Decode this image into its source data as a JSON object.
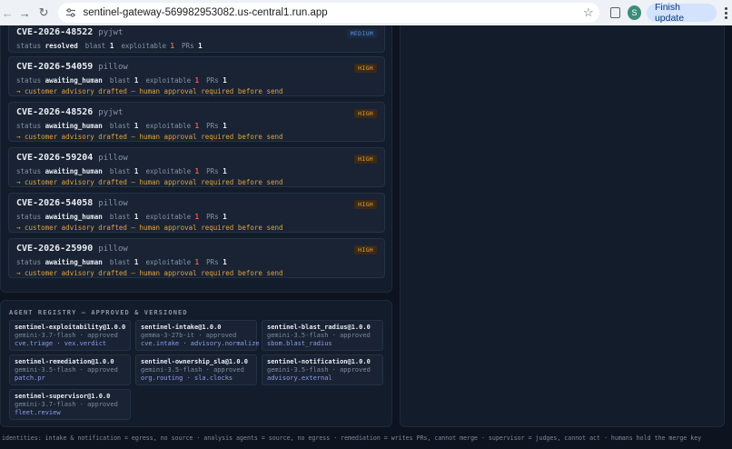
{
  "browser": {
    "url": "sentinel-gateway-569982953082.us-central1.run.app",
    "avatar_letter": "S",
    "finish_update_label": "Finish update"
  },
  "labels": {
    "status": "status",
    "blast": "blast",
    "exploitable": "exploitable",
    "prs": "PRs"
  },
  "incidents": [
    {
      "cve": "CVE-2026-48522",
      "package": "pyjwt",
      "severity": "MEDIUM",
      "status": "resolved",
      "blast": "1",
      "exploitable": "1",
      "prs": "1",
      "note": ""
    },
    {
      "cve": "CVE-2026-54059",
      "package": "pillow",
      "severity": "HIGH",
      "status": "awaiting_human",
      "blast": "1",
      "exploitable": "1",
      "prs": "1",
      "note": "→ customer advisory drafted — human approval required before send"
    },
    {
      "cve": "CVE-2026-48526",
      "package": "pyjwt",
      "severity": "HIGH",
      "status": "awaiting_human",
      "blast": "1",
      "exploitable": "1",
      "prs": "1",
      "note": "→ customer advisory drafted — human approval required before send"
    },
    {
      "cve": "CVE-2026-59204",
      "package": "pillow",
      "severity": "HIGH",
      "status": "awaiting_human",
      "blast": "1",
      "exploitable": "1",
      "prs": "1",
      "note": "→ customer advisory drafted — human approval required before send"
    },
    {
      "cve": "CVE-2026-54058",
      "package": "pillow",
      "severity": "HIGH",
      "status": "awaiting_human",
      "blast": "1",
      "exploitable": "1",
      "prs": "1",
      "note": "→ customer advisory drafted — human approval required before send"
    },
    {
      "cve": "CVE-2026-25990",
      "package": "pillow",
      "severity": "HIGH",
      "status": "awaiting_human",
      "blast": "1",
      "exploitable": "1",
      "prs": "1",
      "note": "→ customer advisory drafted — human approval required before send"
    }
  ],
  "registry": {
    "title": "AGENT REGISTRY — APPROVED & VERSIONED",
    "agents": [
      {
        "name": "sentinel-exploitability@1.0.0",
        "model": "gemini-3.7-flash · approved",
        "caps": "cve.triage · vex.verdict"
      },
      {
        "name": "sentinel-intake@1.0.0",
        "model": "gemma-3-27b-it · approved",
        "caps": "cve.intake · advisory.normalize"
      },
      {
        "name": "sentinel-blast_radius@1.0.0",
        "model": "gemini-3.5-flash · approved",
        "caps": "sbom.blast_radius"
      },
      {
        "name": "sentinel-remediation@1.0.0",
        "model": "gemini-3.5-flash · approved",
        "caps": "patch.pr"
      },
      {
        "name": "sentinel-ownership_sla@1.0.0",
        "model": "gemini-3.5-flash · approved",
        "caps": "org.routing · sla.clocks"
      },
      {
        "name": "sentinel-notification@1.0.0",
        "model": "gemini-3.5-flash · approved",
        "caps": "advisory.external"
      },
      {
        "name": "sentinel-supervisor@1.0.0",
        "model": "gemini-3.7-flash · approved",
        "caps": "fleet.review"
      }
    ]
  },
  "footer": "identities: intake & notification = egress, no source · analysis agents = source, no egress · remediation = writes PRs, cannot merge · supervisor = judges, cannot act · humans hold the merge key",
  "colors": {
    "background": "#0d1420",
    "panel": "#131c2a",
    "card": "#192333",
    "high_badge": "#e8a23a",
    "medium_badge": "#5b8fd6",
    "exploitable": "#ef5b5b",
    "note": "#e0a340",
    "capability": "#8f9cf0"
  }
}
